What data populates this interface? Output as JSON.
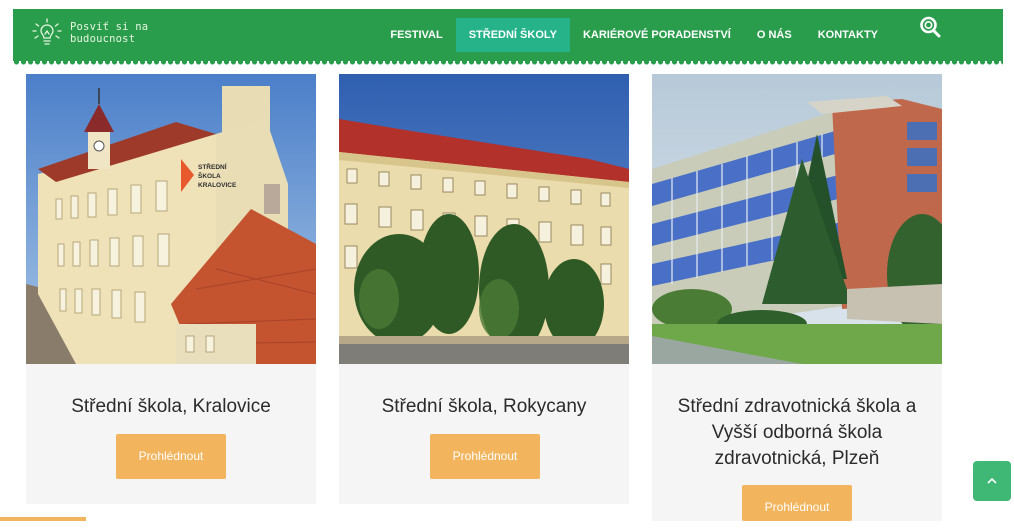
{
  "brand": {
    "line1": "Posviť si na",
    "line2": "budoucnost",
    "logo_icon": "lightbulb-icon"
  },
  "nav": {
    "items": [
      {
        "label": "FESTIVAL",
        "active": false
      },
      {
        "label": "STŘEDNÍ ŠKOLY",
        "active": true
      },
      {
        "label": "KARIÉROVÉ PORADENSTVÍ",
        "active": false
      },
      {
        "label": "O NÁS",
        "active": false
      },
      {
        "label": "KONTAKTY",
        "active": false
      }
    ],
    "search_icon": "search-icon"
  },
  "schools": [
    {
      "name": "Střední škola, Kralovice",
      "button": "Prohlédnout",
      "sign_text": [
        "STŘEDNÍ",
        "ŠKOLA",
        "KRALOVICE"
      ]
    },
    {
      "name": "Střední škola, Rokycany",
      "button": "Prohlédnout"
    },
    {
      "name": "Střední zdravotnická škola a Vyšší odborná škola zdravotnická, Plzeň",
      "button": "Prohlédnout"
    }
  ],
  "back_to_top_icon": "chevron-up-icon",
  "colors": {
    "nav_bg": "#2a9d4d",
    "nav_active": "#26b38a",
    "button": "#f2b45c",
    "card_bg": "#f5f5f5"
  }
}
